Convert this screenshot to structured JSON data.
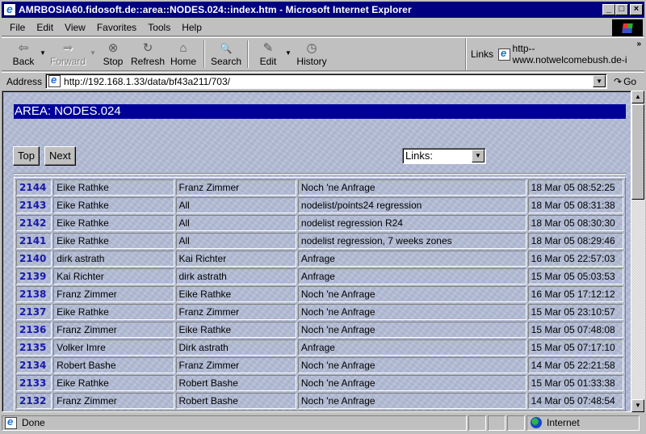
{
  "window": {
    "title": "AMRBOSIA60.fidosoft.de::area::NODES.024::index.htm - Microsoft Internet Explorer",
    "controls": [
      "_",
      "□",
      "×"
    ]
  },
  "menubar": {
    "items": [
      "File",
      "Edit",
      "View",
      "Favorites",
      "Tools",
      "Help"
    ]
  },
  "toolbar": {
    "buttons": [
      {
        "label": "Back",
        "icon": "⇦"
      },
      {
        "label": "Forward",
        "icon": "➡"
      },
      {
        "label": "Stop",
        "icon": "⊗"
      },
      {
        "label": "Refresh",
        "icon": "↻"
      },
      {
        "label": "Home",
        "icon": "⌂"
      },
      {
        "label": "Search",
        "icon": "🔍"
      },
      {
        "label": "Edit",
        "icon": "✎"
      },
      {
        "label": "History",
        "icon": "◷"
      }
    ],
    "links_label": "Links",
    "link_item": "http--www.notwelcomebush.de-i",
    "chevron": "»"
  },
  "address": {
    "label": "Address",
    "url": "http://192.168.1.33/data/bf43a211/703/",
    "go_label": "Go"
  },
  "page": {
    "area_title": "AREA: NODES.024",
    "top_button": "Top",
    "next_button": "Next",
    "links_select": "Links:",
    "messages": [
      {
        "num": "2144",
        "from": "Eike Rathke",
        "to": "Franz Zimmer",
        "subject": "Noch 'ne Anfrage",
        "date": "18 Mar 05 08:52:25"
      },
      {
        "num": "2143",
        "from": "Eike Rathke",
        "to": "All",
        "subject": "nodelist/points24 regression",
        "date": "18 Mar 05 08:31:38"
      },
      {
        "num": "2142",
        "from": "Eike Rathke",
        "to": "All",
        "subject": "nodelist regression R24",
        "date": "18 Mar 05 08:30:30"
      },
      {
        "num": "2141",
        "from": "Eike Rathke",
        "to": "All",
        "subject": "nodelist regression, 7 weeks zones",
        "date": "18 Mar 05 08:29:46"
      },
      {
        "num": "2140",
        "from": "dirk astrath",
        "to": "Kai Richter",
        "subject": "Anfrage",
        "date": "16 Mar 05 22:57:03"
      },
      {
        "num": "2139",
        "from": "Kai Richter",
        "to": "dirk astrath",
        "subject": "Anfrage",
        "date": "15 Mar 05 05:03:53"
      },
      {
        "num": "2138",
        "from": "Franz Zimmer",
        "to": "Eike Rathke",
        "subject": "Noch 'ne Anfrage",
        "date": "16 Mar 05 17:12:12"
      },
      {
        "num": "2137",
        "from": "Eike Rathke",
        "to": "Franz Zimmer",
        "subject": "Noch 'ne Anfrage",
        "date": "15 Mar 05 23:10:57"
      },
      {
        "num": "2136",
        "from": "Franz Zimmer",
        "to": "Eike Rathke",
        "subject": "Noch 'ne Anfrage",
        "date": "15 Mar 05 07:48:08"
      },
      {
        "num": "2135",
        "from": "Volker Imre",
        "to": "Dirk astrath",
        "subject": "Anfrage",
        "date": "15 Mar 05 07:17:10"
      },
      {
        "num": "2134",
        "from": "Robert Bashe",
        "to": "Franz Zimmer",
        "subject": "Noch 'ne Anfrage",
        "date": "14 Mar 05 22:21:58"
      },
      {
        "num": "2133",
        "from": "Eike Rathke",
        "to": "Robert Bashe",
        "subject": "Noch 'ne Anfrage",
        "date": "15 Mar 05 01:33:38"
      },
      {
        "num": "2132",
        "from": "Franz Zimmer",
        "to": "Robert Bashe",
        "subject": "Noch 'ne Anfrage",
        "date": "14 Mar 05 07:48:54"
      }
    ]
  },
  "statusbar": {
    "status": "Done",
    "zone": "Internet"
  },
  "colors": {
    "title_bar": "#000080",
    "area_header": "#000099",
    "message_number": "#1a1aa8",
    "page_background": "#b3bdd6"
  }
}
